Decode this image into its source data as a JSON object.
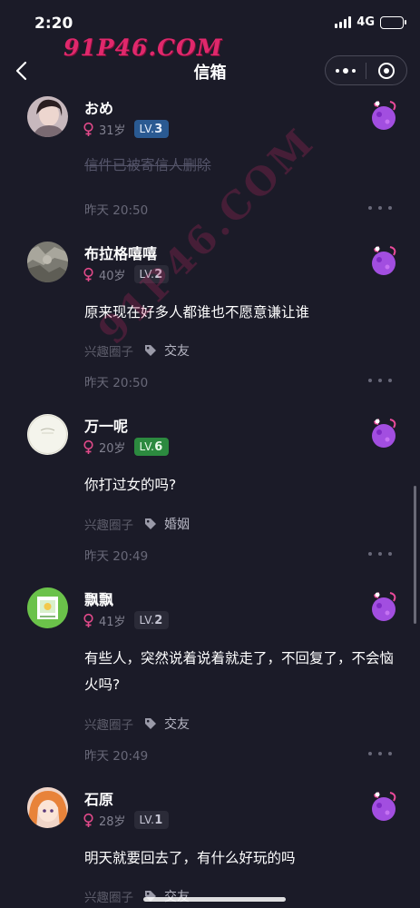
{
  "status_bar": {
    "time": "2:20",
    "network": "4G",
    "battery_level": 1.0
  },
  "watermark": {
    "text": "91P46.COM",
    "diagonal_text": "91P46.COM"
  },
  "nav": {
    "title": "信箱",
    "back_icon": "chevron-left-icon",
    "more_icon": "more-dots-icon",
    "close_icon": "target-circle-icon"
  },
  "posts": [
    {
      "name": "おめ",
      "age": "31岁",
      "level_prefix": "LV.",
      "level": "3",
      "level_color": "blue",
      "content": "信件已被寄信人删除",
      "deleted": true,
      "time": "昨天 20:50",
      "circle": "",
      "tag": ""
    },
    {
      "name": "布拉格嘻嘻",
      "age": "40岁",
      "level_prefix": "LV.",
      "level": "2",
      "level_color": "gray",
      "content": "原来现在好多人都谁也不愿意谦让谁",
      "deleted": false,
      "circle": "兴趣圈子",
      "tag": "交友",
      "time": "昨天 20:50"
    },
    {
      "name": "万一呢",
      "age": "20岁",
      "level_prefix": "LV.",
      "level": "6",
      "level_color": "green",
      "content": "你打过女的吗?",
      "deleted": false,
      "circle": "兴趣圈子",
      "tag": "婚姻",
      "time": "昨天 20:49"
    },
    {
      "name": "飘飘",
      "age": "41岁",
      "level_prefix": "LV.",
      "level": "2",
      "level_color": "gray",
      "content": "有些人，突然说着说着就走了，不回复了，不会恼火吗?",
      "deleted": false,
      "circle": "兴趣圈子",
      "tag": "交友",
      "time": "昨天 20:49"
    },
    {
      "name": "石原",
      "age": "28岁",
      "level_prefix": "LV.",
      "level": "1",
      "level_color": "gray",
      "content": "明天就要回去了，有什么好玩的吗",
      "deleted": false,
      "circle": "兴趣圈子",
      "tag": "交友",
      "time": ""
    }
  ],
  "colors": {
    "background": "#1b1b28",
    "female": "#e24a8a",
    "level_blue": "#2a5a92",
    "level_green": "#2c8a3f",
    "watermark": "#e0286c"
  }
}
